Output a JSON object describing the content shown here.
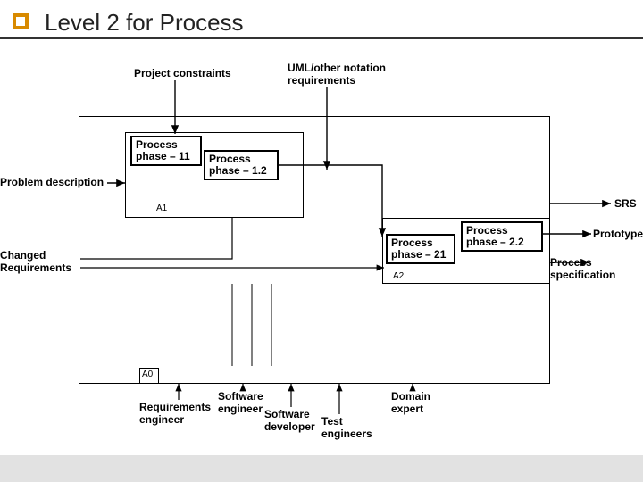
{
  "title": "Level 2 for Process",
  "labels": {
    "project_constraints": "Project constraints",
    "uml_req": "UML/other notation\nrequirements",
    "problem_desc": "Problem description",
    "changed_req": "Changed\nRequirements",
    "srs": "SRS",
    "prototype": "Prototype",
    "proc_spec": "Process specification",
    "req_eng": "Requirements\nengineer",
    "sw_eng": "Software\nengineer",
    "sw_dev": "Software\ndeveloper",
    "test_eng": "Test\nengineers",
    "domain_exp": "Domain\nexpert"
  },
  "phases": {
    "p11": "Process\nphase – 11",
    "p12": "Process\nphase – 1.2",
    "p21": "Process\nphase – 21",
    "p22": "Process\nphase – 2.2"
  },
  "tags": {
    "a0": "A0",
    "a1": "A1",
    "a2": "A2"
  }
}
